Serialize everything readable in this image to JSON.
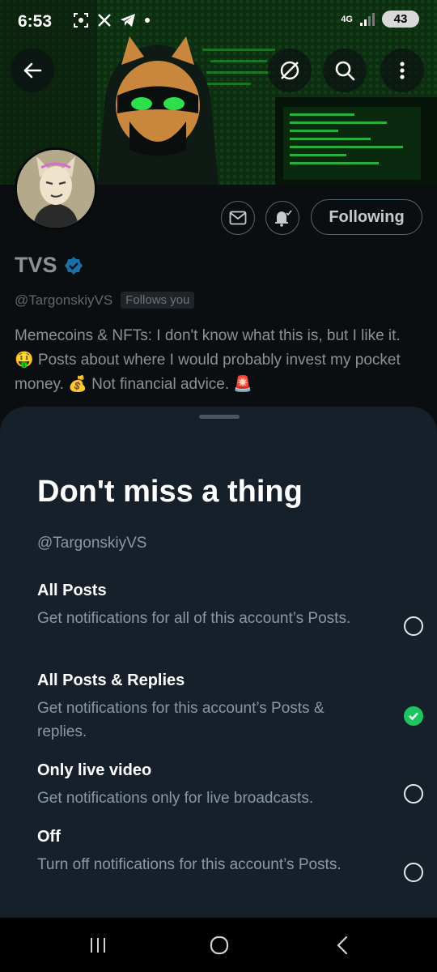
{
  "status_bar": {
    "time": "6:53",
    "network": "4G",
    "battery": "43",
    "icons": [
      "screenshot-icon",
      "x-icon",
      "telegram-icon",
      "dot-icon",
      "signal-icon"
    ]
  },
  "profile": {
    "display_name": "TVS",
    "handle": "@TargonskiyVS",
    "follows_you": "Follows you",
    "bio": "Memecoins & NFTs: I don't know what this is, but I like it. 🤑 Posts about where I would probably invest my pocket money. 💰 Not financial advice. 🚨",
    "following_button": "Following",
    "verified": true
  },
  "sheet": {
    "title": "Don't miss a thing",
    "handle": "@TargonskiyVS",
    "options": [
      {
        "title": "All Posts",
        "description": "Get notifications for all of this account’s Posts.",
        "selected": false
      },
      {
        "title": "All Posts & Replies",
        "description": "Get notifications for this account’s Posts & replies.",
        "selected": true
      },
      {
        "title": "Only live video",
        "description": "Get notifications only for live broadcasts.",
        "selected": false
      },
      {
        "title": "Off",
        "description": "Turn off notifications for this account’s Posts.",
        "selected": false
      }
    ]
  },
  "colors": {
    "accent_green": "#1ec45e",
    "sheet_bg": "#15202b",
    "verified_blue": "#1d9bf0"
  }
}
